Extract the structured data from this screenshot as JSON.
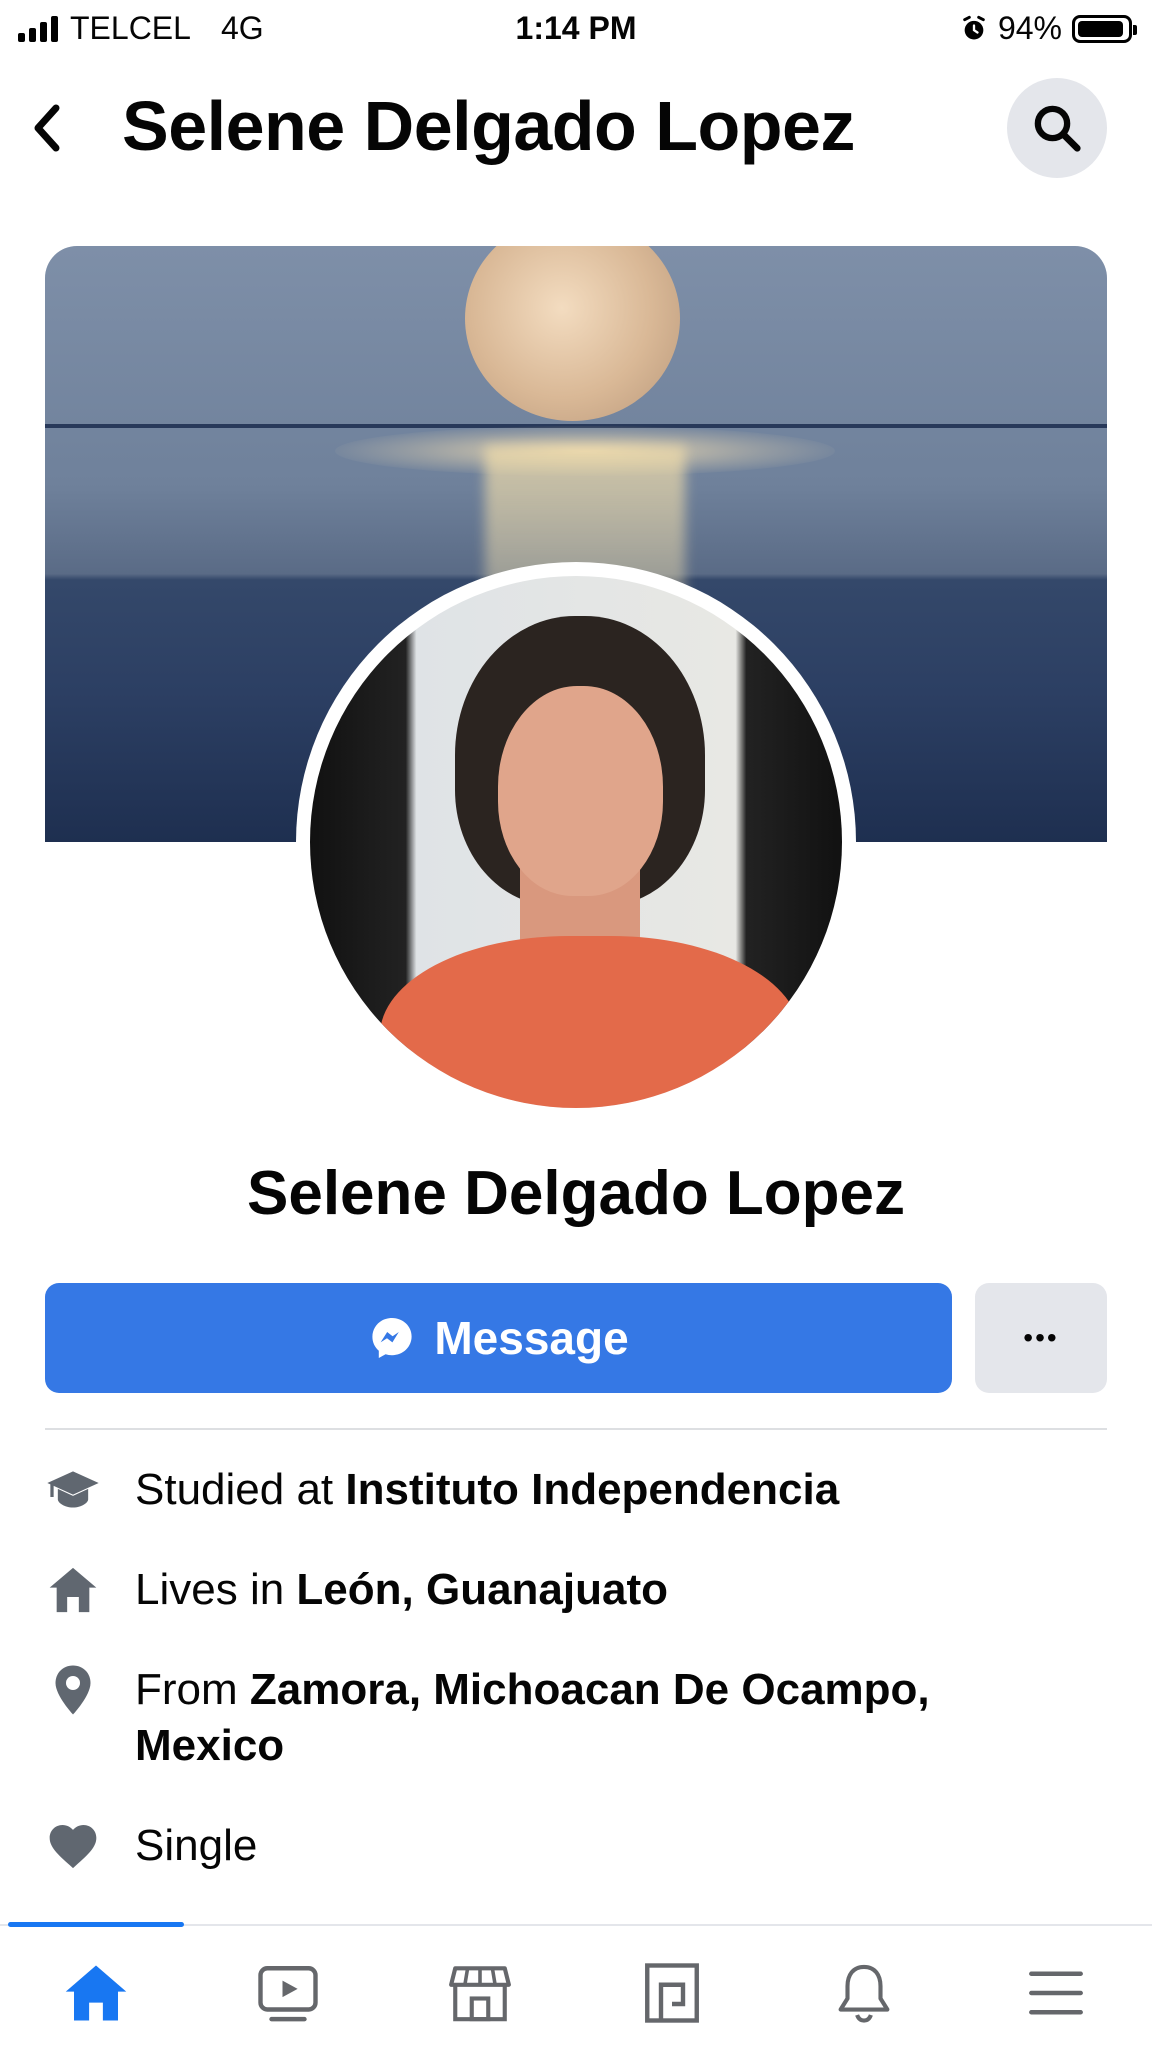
{
  "status_bar": {
    "carrier": "TELCEL",
    "network": "4G",
    "time": "1:14 PM",
    "battery_percent": "94%",
    "battery_level": 0.94
  },
  "header": {
    "title": "Selene Delgado Lopez"
  },
  "profile": {
    "name": "Selene Delgado Lopez"
  },
  "actions": {
    "message_label": "Message",
    "more_label": "•••"
  },
  "details": [
    {
      "icon": "graduation-cap-icon",
      "prefix": "Studied at ",
      "value": "Instituto Independencia"
    },
    {
      "icon": "home-icon",
      "prefix": "Lives in ",
      "value": "León, Guanajuato"
    },
    {
      "icon": "location-pin-icon",
      "prefix": "From ",
      "value": "Zamora, Michoacan De Ocampo, Mexico"
    },
    {
      "icon": "heart-icon",
      "prefix": "",
      "value": "Single"
    }
  ],
  "tabbar": {
    "items": [
      "home-icon",
      "watch-icon",
      "marketplace-icon",
      "pages-icon",
      "notifications-icon",
      "menu-icon"
    ],
    "active": "home-icon",
    "colors": {
      "active": "#1877f2",
      "inactive": "#65676b"
    }
  },
  "colors": {
    "primary_button": "#3578e5",
    "secondary_button": "#e4e6eb"
  }
}
